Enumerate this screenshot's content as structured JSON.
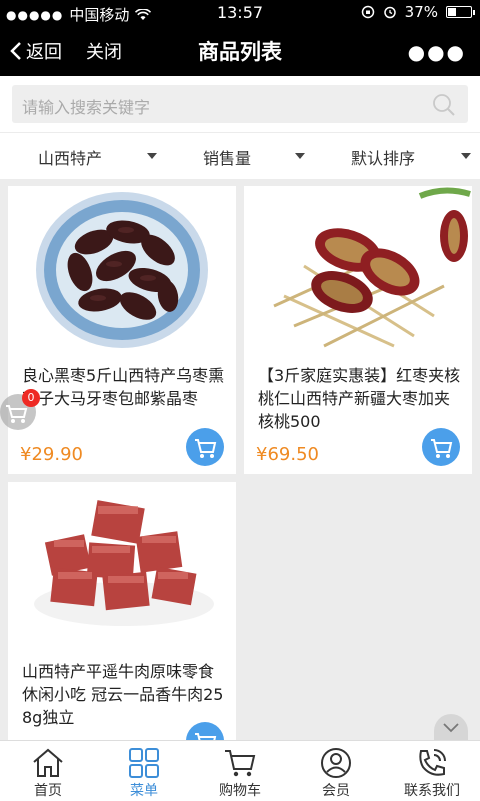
{
  "status": {
    "carrier": "中国移动",
    "time": "13:57",
    "battery": "37%",
    "battery_level": 0.37
  },
  "nav": {
    "back_label": "返回",
    "close_label": "关闭",
    "title": "商品列表",
    "more_icon": "more-dots-icon"
  },
  "search": {
    "placeholder": "请输入搜索关键字"
  },
  "filters": [
    {
      "label": "山西特产"
    },
    {
      "label": "销售量"
    },
    {
      "label": "默认排序"
    }
  ],
  "products": [
    {
      "name": "良心黑枣5斤山西特产乌枣熏枣子大马牙枣包邮紫晶枣",
      "price": "¥29.90"
    },
    {
      "name": "【3斤家庭实惠装】红枣夹核桃仁山西特产新疆大枣加夹核桃500",
      "price": "¥69.50"
    },
    {
      "name": "山西特产平遥牛肉原味零食休闲小吃 冠云一品香牛肉258g独立",
      "price": ""
    }
  ],
  "cart_badge": "0",
  "tabs": [
    {
      "label": "首页",
      "icon": "home-icon"
    },
    {
      "label": "菜单",
      "icon": "menu-grid-icon"
    },
    {
      "label": "购物车",
      "icon": "cart-icon"
    },
    {
      "label": "会员",
      "icon": "member-icon"
    },
    {
      "label": "联系我们",
      "icon": "phone-icon"
    }
  ],
  "colors": {
    "accent": "#3d8ed8",
    "price": "#ef8a22",
    "cart_button": "#4b9fea",
    "badge": "#ee2a24"
  }
}
